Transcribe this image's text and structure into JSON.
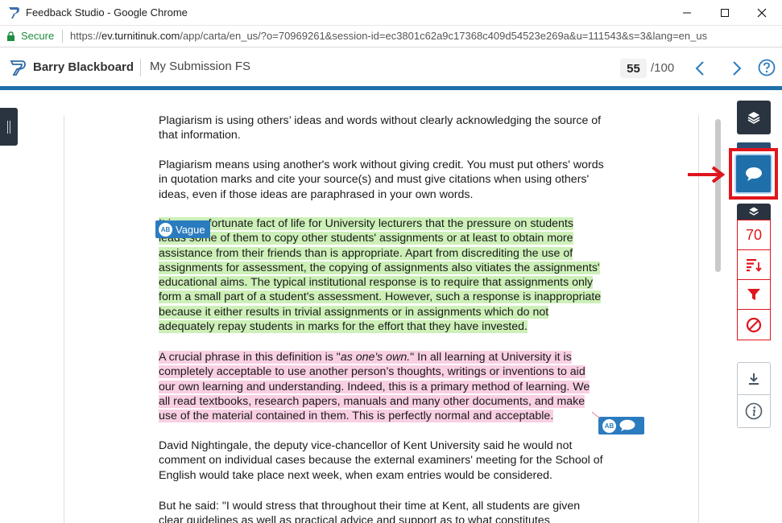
{
  "window": {
    "title": "Feedback Studio - Google Chrome",
    "minimize_icon": "minimize-icon",
    "maximize_icon": "maximize-icon",
    "close_icon": "close-icon"
  },
  "addressbar": {
    "secure_label": "Secure",
    "url_scheme": "https://",
    "url_host": "ev.turnitinuk.com",
    "url_path": "/app/carta/en_us/?o=70969261&session-id=ec3801c62a9c17368c409d54523e269a&u=111543&s=3&lang=en_us"
  },
  "header": {
    "user_name": "Barry Blackboard",
    "submission_title": "My Submission FS",
    "score": "55",
    "score_total": "/100"
  },
  "document": {
    "p1": "Plagiarism is using others’ ideas and words without clearly acknowledging the source of that information.",
    "p2": "Plagiarism means using another's work without giving credit. You must put others' words in quotation marks and cite your source(s) and must give citations when using others' ideas, even if those ideas are paraphrased in your own words.",
    "p3": "It is an unfortunate fact of life for University lecturers that the pressure on students leads some of them to copy other students' assignments or at least to obtain more assistance from their friends than is appropriate. Apart from discrediting the use of assignments for assessment, the copying of assignments also vitiates the assignments' educational aims. The typical institutional response is to require that assignments only form a small part of a student's assessment. However, such a response is inappropriate because it either results in trivial assignments or in assignments which do not adequately repay students in marks for the effort that they have invested.",
    "p4_before": "A crucial phrase in this definition is \"",
    "p4_em": "as one's own.",
    "p4_after": "\" In all learning at University it is completely acceptable to use another person’s thoughts, writings or inventions to aid our own learning and understanding. Indeed, this is a primary method of learning. We all read textbooks, research papers, manuals and many other documents, and make use of the material contained in them. This is perfectly normal and acceptable.",
    "p5": "David Nightingale, the deputy vice-chancellor of Kent University said he would not comment on individual cases because the external examiners' meeting for the School of English would take place next week, when exam entries would be considered.",
    "p6": "But he said: \"I would stress that throughout their time at Kent, all students are given clear guidelines as well as practical advice and support as to what constitutes"
  },
  "tags": {
    "vague_ab": "AB",
    "vague_label": "Vague",
    "bubble_ab": "AB"
  },
  "rail": {
    "similarity_score": "70"
  },
  "colors": {
    "accent_blue": "#1f6fab",
    "rail_dark": "#2a3441",
    "alert_red": "#e0151d",
    "highlight_green": "#cdf0b8",
    "highlight_pink": "#f9cfe3"
  }
}
